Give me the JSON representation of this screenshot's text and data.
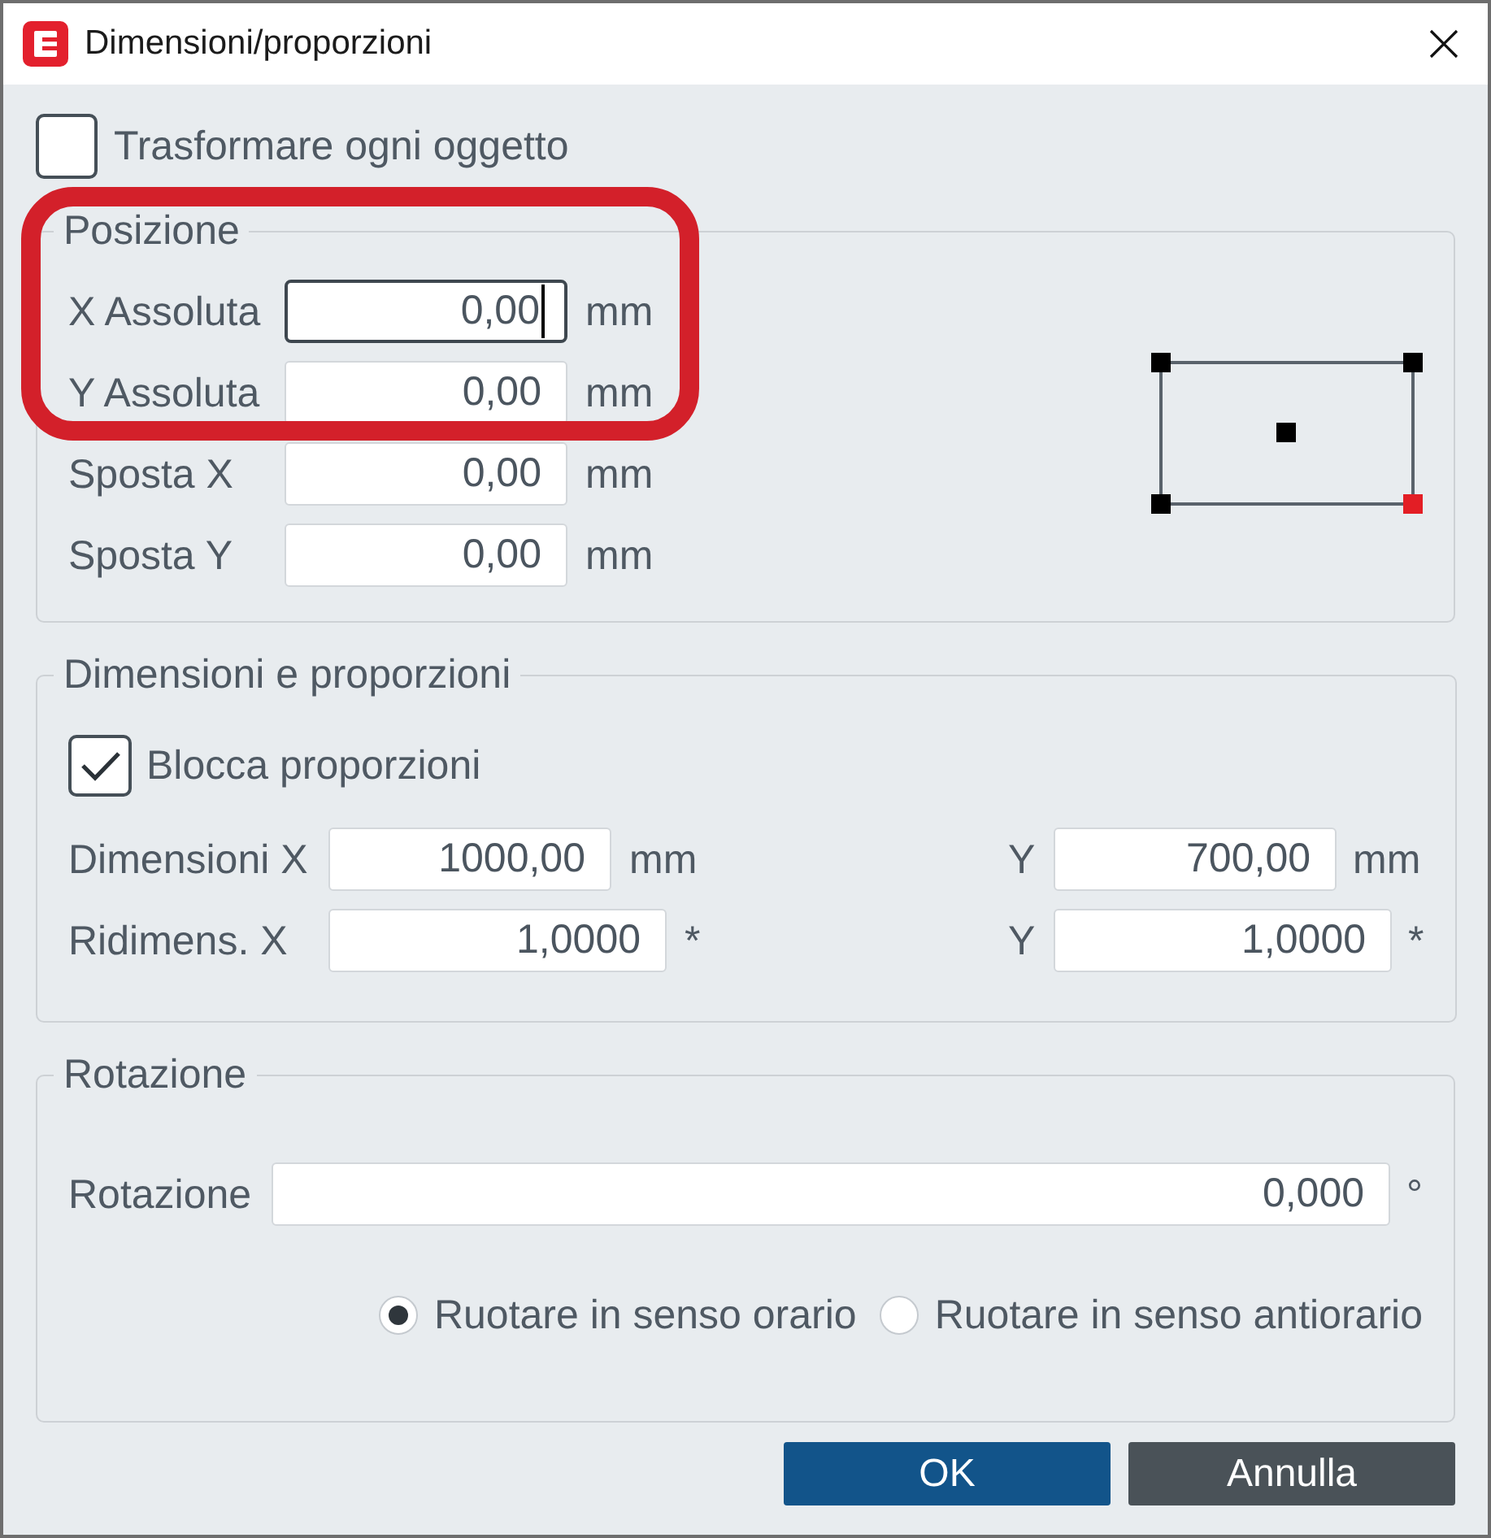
{
  "window": {
    "title": "Dimensioni/proporzioni"
  },
  "transform_each": {
    "label": "Trasformare ogni oggetto",
    "checked": false
  },
  "position": {
    "legend": "Posizione",
    "rows": [
      {
        "label": "X Assoluta",
        "value": "0,00",
        "unit": "mm",
        "focused": true,
        "highlighted": true
      },
      {
        "label": "Y Assoluta",
        "value": "0,00",
        "unit": "mm",
        "focused": false,
        "highlighted": true
      },
      {
        "label": "Sposta X",
        "value": "0,00",
        "unit": "mm",
        "focused": false,
        "highlighted": false
      },
      {
        "label": "Sposta Y",
        "value": "0,00",
        "unit": "mm",
        "focused": false,
        "highlighted": false
      }
    ],
    "reference_points": [
      {
        "kind": "top-left",
        "selected": false
      },
      {
        "kind": "top-right",
        "selected": false
      },
      {
        "kind": "center",
        "selected": false
      },
      {
        "kind": "bottom-left",
        "selected": false
      },
      {
        "kind": "bottom-right",
        "selected": true
      }
    ]
  },
  "size": {
    "legend": "Dimensioni e proporzioni",
    "lock": {
      "label": "Blocca proporzioni",
      "checked": true
    },
    "rows": [
      {
        "kind": "dimension",
        "x": {
          "label": "Dimensioni X",
          "value": "1000,00",
          "unit": "mm"
        },
        "y": {
          "label": "Y",
          "value": "700,00",
          "unit": "mm"
        }
      },
      {
        "kind": "scale",
        "x": {
          "label": "Ridimens. X",
          "value": "1,0000",
          "unit": "*"
        },
        "y": {
          "label": "Y",
          "value": "1,0000",
          "unit": "*"
        }
      }
    ]
  },
  "rotation": {
    "legend": "Rotazione",
    "label": "Rotazione",
    "value": "0,000",
    "unit": "°",
    "directions": [
      {
        "label": "Ruotare in senso orario",
        "selected": true
      },
      {
        "label": "Ruotare in senso antiorario",
        "selected": false
      }
    ]
  },
  "buttons": [
    {
      "label": "OK",
      "kind": "primary"
    },
    {
      "label": "Annulla",
      "kind": "secondary"
    }
  ]
}
